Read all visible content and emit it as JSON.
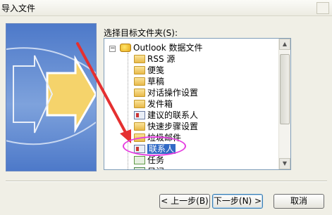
{
  "window": {
    "title": "导入文件"
  },
  "folder_label": "选择目标文件夹(S):",
  "tree": {
    "root": {
      "label": "Outlook 数据文件",
      "expander": "−"
    },
    "items": [
      {
        "label": "RSS 源",
        "icon": "folder-icon"
      },
      {
        "label": "便笺",
        "icon": "folder-icon"
      },
      {
        "label": "草稿",
        "icon": "folder-icon"
      },
      {
        "label": "对话操作设置",
        "icon": "folder-icon"
      },
      {
        "label": "发件箱",
        "icon": "folder-icon"
      },
      {
        "label": "建议的联系人",
        "icon": "contact-icon"
      },
      {
        "label": "快速步骤设置",
        "icon": "folder-icon"
      },
      {
        "label": "垃圾邮件",
        "icon": "folder-icon"
      },
      {
        "label": "联系人",
        "icon": "contact-icon",
        "selected": true
      },
      {
        "label": "任务",
        "icon": "task-icon"
      },
      {
        "label": "日记",
        "icon": "calendar-icon"
      }
    ]
  },
  "buttons": {
    "back": "< 上一步(B)",
    "next": "下一步(N) >",
    "cancel": "取消"
  },
  "colors": {
    "selection": "#316ac5",
    "annotation_arrow": "#e53030",
    "annotation_ellipse": "#e53de0"
  }
}
